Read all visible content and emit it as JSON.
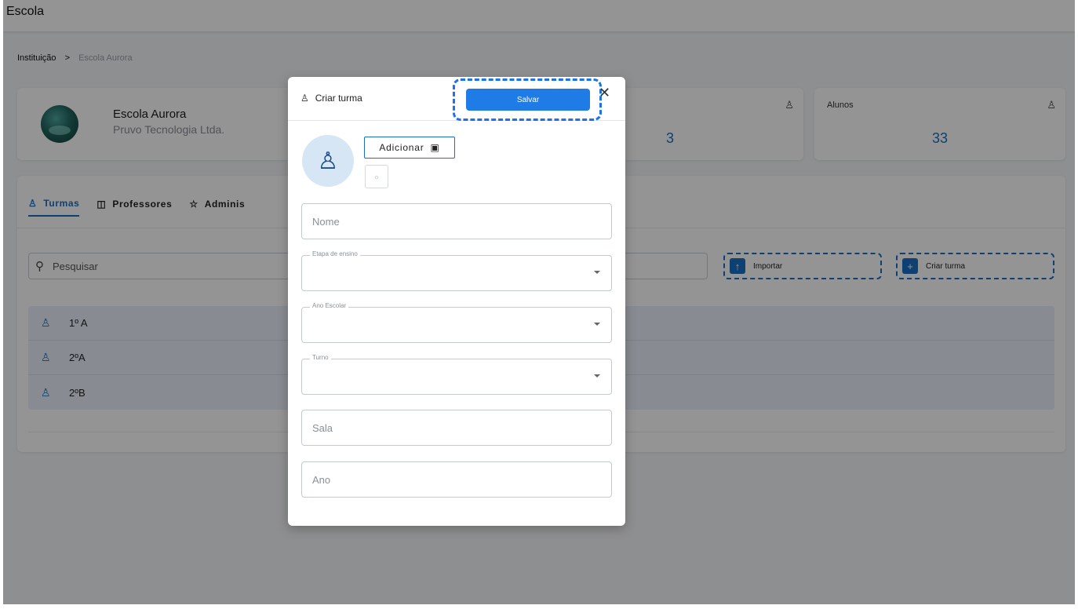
{
  "app": {
    "title": "Escola"
  },
  "breadcrumb": {
    "root": "Instituição",
    "separator": ">",
    "current": "Escola Aurora"
  },
  "school": {
    "name": "Escola Aurora",
    "company": "Pruvo Tecnologia Ltda."
  },
  "stats": [
    {
      "label": "",
      "value": "3",
      "icon": "group-icon"
    },
    {
      "label": "Alunos",
      "value": "33",
      "icon": "user-icon"
    }
  ],
  "tabs": [
    {
      "label": "Turmas",
      "icon": "group-icon",
      "active": true
    },
    {
      "label": "Professores",
      "icon": "board-icon",
      "active": false
    },
    {
      "label": "Adminis",
      "icon": "admin-icon",
      "active": false
    }
  ],
  "search": {
    "placeholder": "Pesquisar"
  },
  "actions": {
    "import_label": "Importar",
    "create_label": "Criar turma"
  },
  "classes": [
    "1º A",
    "2ºA",
    "2ºB"
  ],
  "modal": {
    "title": "Criar turma",
    "save_label": "Salvar",
    "add_image_label": "Adicionar",
    "fields": {
      "nome": "Nome",
      "etapa": "Etapa de ensino",
      "ano_escolar": "Ano Escolar",
      "turno": "Turno",
      "sala": "Sala",
      "ano": "Ano"
    }
  },
  "colors": {
    "accent": "#1a6fc4",
    "save_button": "#1f7be6",
    "overlay": "rgba(0,0,0,0.42)"
  }
}
